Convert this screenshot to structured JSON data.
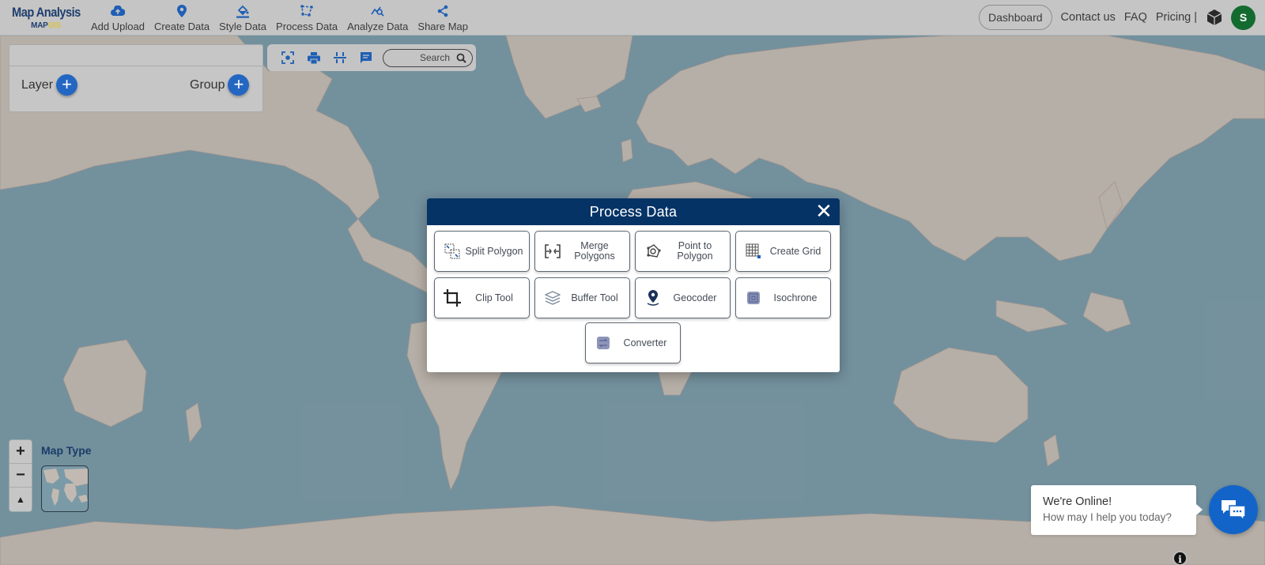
{
  "brand": {
    "title": "Map Analysis",
    "sub_prefix": "MAP",
    "sub_suffix": "GIS"
  },
  "nav": [
    {
      "label": "Add Upload",
      "icon": "cloud-upload-icon"
    },
    {
      "label": "Create Data",
      "icon": "map-pin-icon"
    },
    {
      "label": "Style Data",
      "icon": "paint-bucket-icon"
    },
    {
      "label": "Process Data",
      "icon": "process-polygon-icon"
    },
    {
      "label": "Analyze Data",
      "icon": "analyze-icon"
    },
    {
      "label": "Share Map",
      "icon": "share-icon"
    }
  ],
  "right_nav": {
    "dashboard": "Dashboard",
    "contact": "Contact us",
    "faq": "FAQ",
    "pricing": "Pricing |",
    "avatar_initial": "S"
  },
  "layer_panel": {
    "layer_label": "Layer",
    "group_label": "Group",
    "plus": "+"
  },
  "toolstrip": {
    "search_label": "Search"
  },
  "modal": {
    "title": "Process Data",
    "close": "✕",
    "buttons": [
      {
        "label": "Split Polygon",
        "icon": "split-polygon-icon"
      },
      {
        "label": "Merge Polygons",
        "icon": "merge-polygons-icon"
      },
      {
        "label": "Point to Polygon",
        "icon": "point-to-polygon-icon"
      },
      {
        "label": "Create Grid",
        "icon": "create-grid-icon"
      },
      {
        "label": "Clip Tool",
        "icon": "crop-icon"
      },
      {
        "label": "Buffer Tool",
        "icon": "layers-icon"
      },
      {
        "label": "Geocoder",
        "icon": "location-pin-icon"
      },
      {
        "label": "Isochrone",
        "icon": "isochrone-icon"
      },
      {
        "label": "Converter",
        "icon": "converter-icon"
      }
    ]
  },
  "map_controls": {
    "zoom_in": "+",
    "zoom_out": "−",
    "reset": "▲",
    "map_type_label": "Map Type"
  },
  "chat": {
    "title": "We're Online!",
    "subtitle": "How may I help you today?"
  },
  "info": "i",
  "colors": {
    "accent": "#1f5fb5",
    "modal_header": "#053366",
    "avatar": "#146b30",
    "chat": "#1364c8",
    "water": "#7b9aa7",
    "land": "#c2bab2"
  }
}
